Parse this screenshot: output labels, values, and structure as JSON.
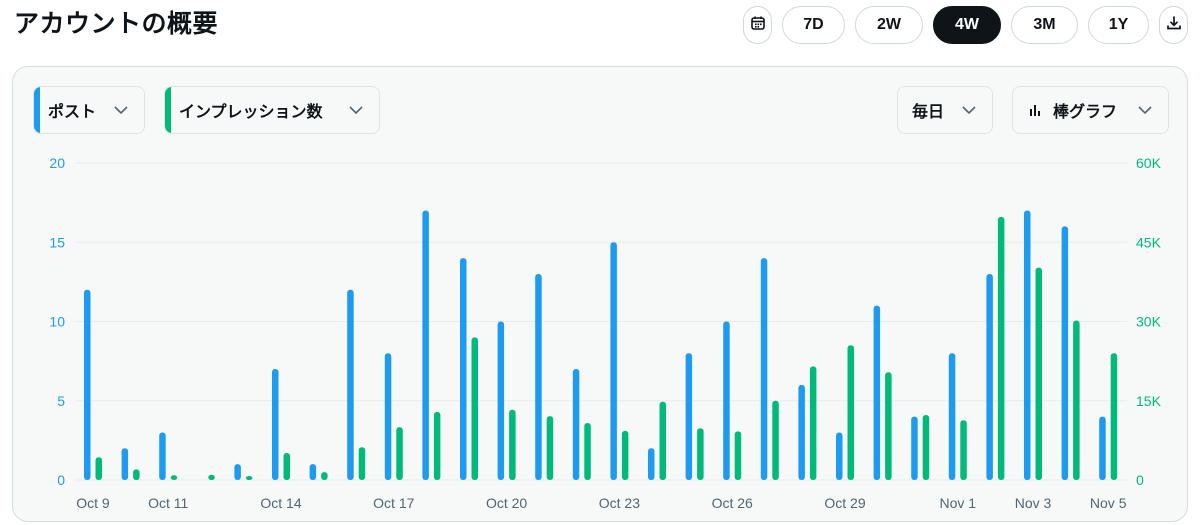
{
  "header": {
    "title": "アカウントの概要"
  },
  "range_selector": {
    "options": [
      "7D",
      "2W",
      "4W",
      "3M",
      "1Y"
    ],
    "selected": "4W",
    "calendar_icon": "calendar-icon",
    "download_icon": "download-icon"
  },
  "controls": {
    "metric_left": "ポスト",
    "metric_right": "インプレッション数",
    "interval": "毎日",
    "chart_type": "棒グラフ"
  },
  "colors": {
    "posts": "#1d9bf0",
    "impressions": "#00ba7c",
    "active": "#0f1419"
  },
  "chart_data": {
    "type": "bar",
    "x": [
      "Oct 9",
      "Oct 10",
      "Oct 11",
      "Oct 12",
      "Oct 13",
      "Oct 14",
      "Oct 15",
      "Oct 16",
      "Oct 17",
      "Oct 18",
      "Oct 19",
      "Oct 20",
      "Oct 21",
      "Oct 22",
      "Oct 23",
      "Oct 24",
      "Oct 25",
      "Oct 26",
      "Oct 27",
      "Oct 28",
      "Oct 29",
      "Oct 30",
      "Oct 31",
      "Nov 1",
      "Nov 2",
      "Nov 3",
      "Nov 4",
      "Nov 5"
    ],
    "xtick_labels": [
      "Oct 9",
      "",
      "Oct 11",
      "",
      "",
      "Oct 14",
      "",
      "",
      "Oct 17",
      "",
      "",
      "Oct 20",
      "",
      "",
      "Oct 23",
      "",
      "",
      "Oct 26",
      "",
      "",
      "Oct 29",
      "",
      "",
      "Nov 1",
      "",
      "Nov 3",
      "",
      "Nov 5"
    ],
    "series": [
      {
        "name": "ポスト",
        "axis": "left",
        "color": "#1d9bf0",
        "values": [
          12,
          2,
          3,
          0,
          1,
          7,
          1,
          12,
          8,
          17,
          14,
          10,
          13,
          7,
          15,
          2,
          8,
          10,
          14,
          6,
          3,
          11,
          4,
          8,
          13,
          17,
          16,
          4
        ]
      },
      {
        "name": "インプレッション数",
        "axis": "right",
        "color": "#00ba7c",
        "values": [
          4300,
          2000,
          900,
          1000,
          700,
          5100,
          1500,
          6200,
          10000,
          12900,
          27000,
          13300,
          12100,
          10800,
          9300,
          14800,
          9800,
          9200,
          15000,
          21500,
          25500,
          20400,
          12300,
          11300,
          49800,
          40200,
          30200,
          24000
        ]
      }
    ],
    "y_left": {
      "ticks": [
        "0",
        "5",
        "10",
        "15",
        "20"
      ],
      "lim": [
        0,
        20
      ]
    },
    "y_right": {
      "ticks": [
        "0",
        "15K",
        "30K",
        "45K",
        "60K"
      ],
      "lim": [
        0,
        60000
      ]
    },
    "grid": true
  }
}
